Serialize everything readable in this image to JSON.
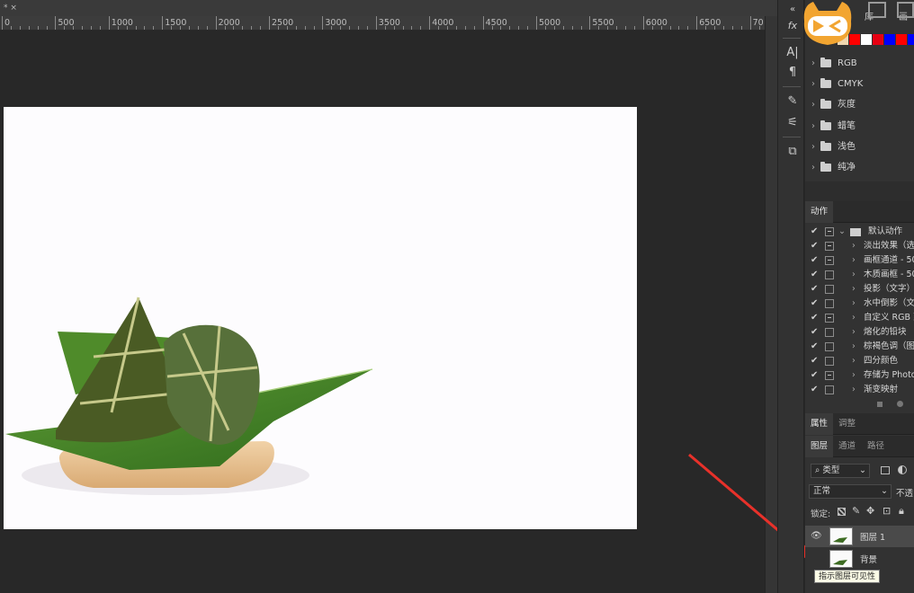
{
  "document_tab": {
    "label": "* ×"
  },
  "ruler": {
    "ticks": [
      "0",
      "500",
      "1000",
      "1500",
      "2000",
      "2500",
      "3000",
      "3500",
      "4000",
      "4500",
      "5000",
      "5500",
      "6000",
      "6500",
      "70"
    ]
  },
  "swatches": [
    "#f0d7b0",
    "#ff0000",
    "#ffffff",
    "#e60012",
    "#0000ff",
    "#ff0000",
    "#0000ff"
  ],
  "swatch_folders": [
    "RGB",
    "CMYK",
    "灰度",
    "蜡笔",
    "浅色",
    "纯净"
  ],
  "actions_panel": {
    "tab": "动作",
    "set_name": "默认动作",
    "items": [
      {
        "label": "淡出效果（选",
        "checked": true,
        "dialog": true
      },
      {
        "label": "画框通道 - 50",
        "checked": true,
        "dialog": true
      },
      {
        "label": "木质画框 - 50",
        "checked": true,
        "dialog": false
      },
      {
        "label": "投影（文字）",
        "checked": true,
        "dialog": false
      },
      {
        "label": "水中倒影（文",
        "checked": true,
        "dialog": false
      },
      {
        "label": "自定义 RGB 到",
        "checked": true,
        "dialog": true
      },
      {
        "label": "熔化的铅块",
        "checked": true,
        "dialog": false
      },
      {
        "label": "棕褐色调（图",
        "checked": true,
        "dialog": false
      },
      {
        "label": "四分颜色",
        "checked": true,
        "dialog": false
      },
      {
        "label": "存储为 Photo",
        "checked": true,
        "dialog": true
      },
      {
        "label": "渐变映射",
        "checked": true,
        "dialog": false
      }
    ]
  },
  "properties_tabs": [
    "属性",
    "调整"
  ],
  "layers_tabs": [
    "图层",
    "通道",
    "路径"
  ],
  "layers_panel": {
    "filter_kind": "类型",
    "blend_mode": "正常",
    "opacity_label": "不透",
    "lock_label": "锁定:",
    "layers": [
      {
        "name": "图层 1",
        "visible": true,
        "selected": true
      },
      {
        "name": "背景",
        "visible": false,
        "selected": false
      }
    ]
  },
  "tooltip": "指示图层可见性",
  "top_right_labels": [
    "库",
    "画"
  ]
}
